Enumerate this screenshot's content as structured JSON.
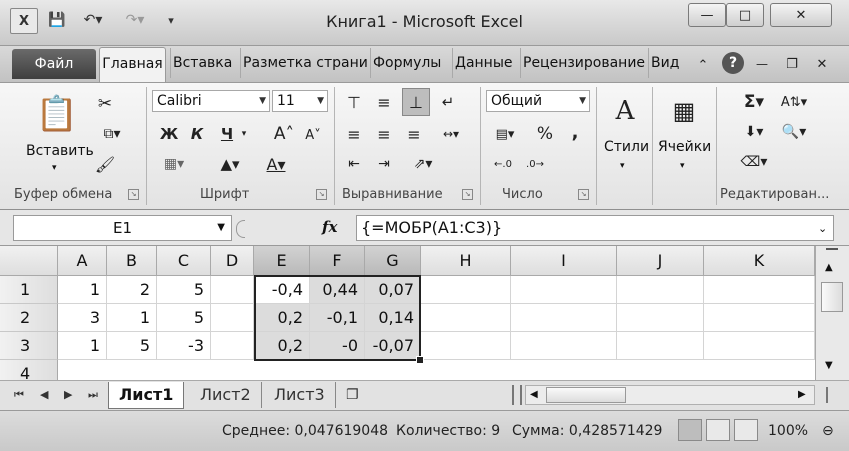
{
  "window": {
    "title": "Книга1  -  Microsoft Excel"
  },
  "ribbon_tabs": [
    "Файл",
    "Главная",
    "Вставка",
    "Разметка страни",
    "Формулы",
    "Данные",
    "Рецензирование",
    "Вид"
  ],
  "ribbon": {
    "clipboard": {
      "paste_label": "Вставить",
      "group_label": "Буфер обмена"
    },
    "font": {
      "name": "Calibri",
      "size": "11",
      "group_label": "Шрифт",
      "bold": "Ж",
      "italic": "К",
      "underline": "Ч"
    },
    "alignment": {
      "group_label": "Выравнивание"
    },
    "number": {
      "format": "Общий",
      "group_label": "Число",
      "percent": "%",
      "comma": ","
    },
    "styles": {
      "label": "Стили"
    },
    "cells": {
      "label": "Ячейки"
    },
    "editing": {
      "group_label": "Редактирован..."
    }
  },
  "formula_bar": {
    "name_box": "E1",
    "fx_label": "fx",
    "formula": "{=МОБР(A1:C3)}"
  },
  "grid": {
    "columns": [
      "A",
      "B",
      "C",
      "D",
      "E",
      "F",
      "G",
      "H",
      "I",
      "J",
      "K"
    ],
    "rows": [
      "1",
      "2",
      "3",
      "4"
    ],
    "cells": {
      "A1": "1",
      "B1": "2",
      "C1": "5",
      "E1": "-0,4",
      "F1": "0,44",
      "G1": "0,07",
      "A2": "3",
      "B2": "1",
      "C2": "5",
      "E2": "0,2",
      "F2": "-0,1",
      "G2": "0,14",
      "A3": "1",
      "B3": "5",
      "C3": "-3",
      "E3": "0,2",
      "F3": "-0",
      "G3": "-0,07"
    }
  },
  "sheets": [
    "Лист1",
    "Лист2",
    "Лист3"
  ],
  "active_sheet": "Лист1",
  "status": {
    "average": "Среднее: 0,047619048",
    "count": "Количество: 9",
    "sum": "Сумма: 0,428571429",
    "zoom": "100%"
  }
}
